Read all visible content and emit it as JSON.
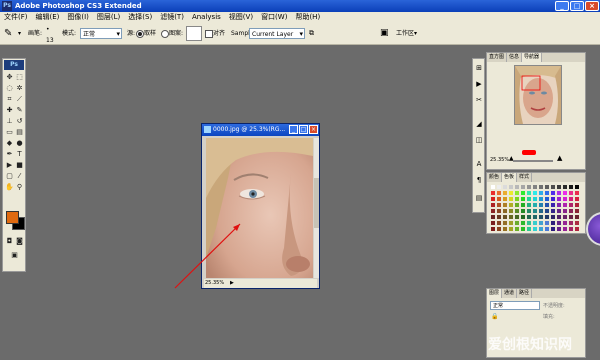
{
  "window": {
    "title": "Adobe Photoshop CS3 Extended",
    "app_icon": "Ps",
    "controls": [
      "_",
      "□",
      "×"
    ]
  },
  "menu": [
    "文件(F)",
    "编辑(E)",
    "图像(I)",
    "图层(L)",
    "选择(S)",
    "滤镜(T)",
    "Analysis",
    "视图(V)",
    "窗口(W)",
    "帮助(H)"
  ],
  "options": {
    "brush_label": "画笔:",
    "brush_size": "13",
    "mode_label": "模式:",
    "mode_value": "正常",
    "source_label": "源:",
    "sampled": "取样",
    "pattern": "图案:",
    "aligned": "对齐",
    "sample_label": "Sample:",
    "sample_value": "Current Layer",
    "workspace": "工作区"
  },
  "toolbox": {
    "logo": "Ps"
  },
  "document": {
    "title": "0000.jpg @ 25.3%(RG...",
    "zoom": "25.35%"
  },
  "navigator": {
    "tabs": [
      "直方图",
      "信息",
      "导航器"
    ],
    "zoom": "25.35%"
  },
  "color_panel": {
    "tabs": [
      "颜色",
      "色板",
      "样式"
    ]
  },
  "layers_panel": {
    "tabs": [
      "图层",
      "通道",
      "路径"
    ],
    "blend_mode": "正常",
    "opacity_label": "不透明度:",
    "fill_label": "填充:"
  },
  "colors": {
    "foreground": "#e06a10",
    "background": "#000000",
    "canvas_bg": "#6b6b6b"
  },
  "watermark": "爱创根知识网"
}
